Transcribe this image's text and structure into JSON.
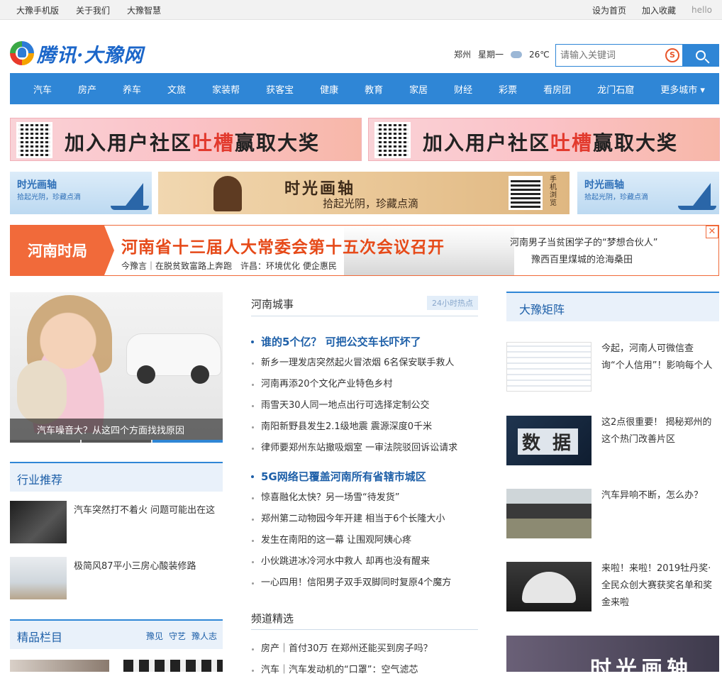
{
  "topbar": {
    "left": [
      "大豫手机版",
      "关于我们",
      "大豫智慧"
    ],
    "right": [
      "设为首页",
      "加入收藏",
      "hello"
    ]
  },
  "header": {
    "logo_text": "腾讯·大豫网",
    "city": "郑州",
    "weekday": "星期一",
    "temperature": "26℃",
    "search_placeholder": "请输入关键词",
    "sogou_mark": "S"
  },
  "nav": [
    "汽车",
    "房产",
    "养车",
    "文旅",
    "家装帮",
    "获客宝",
    "健康",
    "教育",
    "家居",
    "财经",
    "彩票",
    "看房团",
    "龙门石窟",
    "更多城市 ▾"
  ],
  "banners": {
    "community": {
      "pre": "加入用户社区",
      "hl1": "吐",
      "mid": "槽",
      "post": "赢取大奖"
    },
    "timeline_small": {
      "title": "时光画轴",
      "sub": "拾起光阴，珍藏点滴"
    },
    "timeline_mid": {
      "title": "时光画轴",
      "sub": "拾起光阴，珍藏点滴",
      "qr_text": "手机浏览"
    }
  },
  "henan": {
    "label": "河南时局",
    "headline": "河南省十三届人大常委会第十五次会议召开",
    "sub": [
      "今豫言｜在脱贫致富路上奔跑",
      "许昌：环境优化 便企惠民"
    ],
    "right": [
      "河南男子当贫困学子的“梦想合伙人”",
      "豫西百里煤城的沧海桑田"
    ],
    "close": "✕"
  },
  "hero": {
    "caption": "汽车噪音大？从这四个方面找找原因"
  },
  "industry": {
    "title": "行业推荐",
    "items": [
      {
        "text": "汽车突然打不着火 问题可能出在这"
      },
      {
        "text": "极简风87平小三房心酸装修路"
      }
    ]
  },
  "columns": {
    "title": "精品栏目",
    "tags": [
      "豫见",
      "守艺",
      "豫人志"
    ]
  },
  "city_news": {
    "title": "河南城事",
    "badge": "24小时热点",
    "groups": [
      {
        "head": "谁的5个亿？ 可把公交车长吓坏了",
        "lines": [
          "新乡一理发店突然起火冒浓烟 6名保安联手救人",
          "河南再添20个文化产业特色乡村",
          "雨雪天30人同一地点出行可选择定制公交",
          "南阳新野县发生2.1级地震 震源深度0千米",
          "律师要郑州东站撤吸烟室 一审法院驳回诉讼请求"
        ]
      },
      {
        "head": "5G网络已覆盖河南所有省辖市城区",
        "lines": [
          "惊喜融化太快？另一场雪“待发货”",
          "郑州第二动物园今年开建 相当于6个长隆大小",
          "发生在南阳的这一幕 让围观阿姨心疼",
          "小伙跳进冰冷河水中救人 却再也没有醒来",
          "一心四用！信阳男子双手双脚同时复原4个魔方"
        ]
      }
    ]
  },
  "channel": {
    "title": "频道精选",
    "lines": [
      "房产｜首付30万 在郑州还能买到房子吗？",
      "汽车｜汽车发动机的“口罩”：空气滤芯"
    ]
  },
  "matrix": {
    "title": "大豫矩阵",
    "items": [
      {
        "text": "今起，河南人可微信查询“个人信用”！影响每个人"
      },
      {
        "text": "这2点很重要！ 揭秘郑州的这个热门改善片区",
        "thumb_text": "数 据"
      },
      {
        "text": "汽车异响不断，怎么办？"
      },
      {
        "text": "来啦！来啦！2019牡丹奖·全民众创大赛获奖名单和奖金来啦"
      }
    ],
    "bottom_text": "时光画轴"
  }
}
